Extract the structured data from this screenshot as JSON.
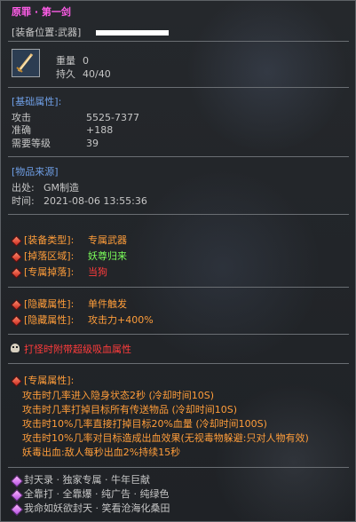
{
  "item": {
    "name": "原罪 · 第一剑",
    "slot_label": "[装备位置:武器]",
    "weight_label": "重量",
    "weight_value": "0",
    "durability_label": "持久",
    "durability_value": "40/40"
  },
  "base_attrs": {
    "header": "[基础属性]:",
    "rows": [
      {
        "label": "攻击",
        "value": "5525-7377"
      },
      {
        "label": "准确",
        "value": "+188"
      },
      {
        "label": "需要等级",
        "value": "39"
      }
    ]
  },
  "source": {
    "header": "[物品来源]",
    "origin_label": "出处:",
    "origin_value": "GM制造",
    "time_label": "时间:",
    "time_value": "2021-08-06 13:55:36"
  },
  "tags": [
    {
      "label": "[装备类型]:",
      "value": "专属武器"
    },
    {
      "label": "[掉落区域]:",
      "value": "妖尊归来"
    },
    {
      "label": "[专属掉落]:",
      "value": "当狗"
    }
  ],
  "hidden": [
    {
      "label": "[隐藏属性]:",
      "value": "单件触发"
    },
    {
      "label": "[隐藏属性]:",
      "value": "攻击力+400%"
    }
  ],
  "vampire_note": "打怪时附带超级吸血属性",
  "exclusive": {
    "header": "[专属属性]:",
    "lines": [
      "攻击时几率进入隐身状态2秒 (冷却时间10S)",
      "攻击时几率打掉目标所有传送物品 (冷却时间10S)",
      "攻击时10%几率直接打掉目标20%血量 (冷却时间100S)",
      "攻击时10%几率对目标造成出血效果(无视毒物躲避:只对人物有效)",
      "妖毒出血:敌人每秒出血2%持续15秒"
    ]
  },
  "footer": [
    "封天录 · 独家专属 · 牛年巨献",
    "全靠打 · 全靠爆 · 纯广告 · 纯绿色",
    "我命如妖欲封天 · 笑看沧海化桑田"
  ]
}
